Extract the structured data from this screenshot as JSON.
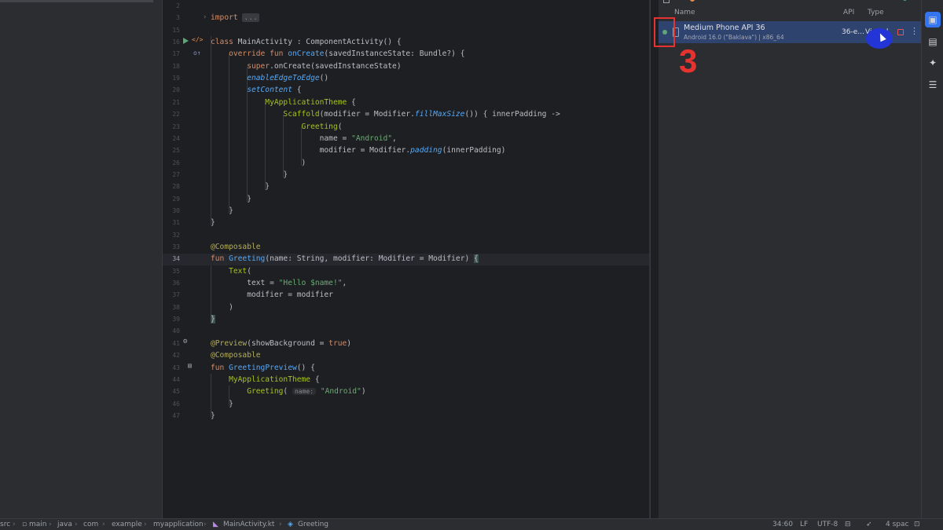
{
  "editor": {
    "lines": [
      {
        "n": "2",
        "tokens": []
      },
      {
        "n": "3",
        "tokens": [
          {
            "c": "kw",
            "t": "import "
          },
          {
            "c": "fold",
            "t": "..."
          }
        ]
      },
      {
        "n": "15",
        "tokens": []
      },
      {
        "n": "16",
        "tokens": [
          {
            "c": "kw",
            "t": "class "
          },
          {
            "c": "txt",
            "t": "MainActivity : ComponentActivity() {"
          }
        ]
      },
      {
        "n": "17",
        "tokens": [
          {
            "c": "kw",
            "t": "    override fun "
          },
          {
            "c": "fn",
            "t": "onCreate"
          },
          {
            "c": "txt",
            "t": "(savedInstanceState: Bundle?) {"
          }
        ]
      },
      {
        "n": "18",
        "tokens": [
          {
            "c": "kw",
            "t": "        super"
          },
          {
            "c": "txt",
            "t": ".onCreate(savedInstanceState)"
          }
        ]
      },
      {
        "n": "19",
        "tokens": [
          {
            "c": "it",
            "t": "        enableEdgeToEdge"
          },
          {
            "c": "txt",
            "t": "()"
          }
        ]
      },
      {
        "n": "20",
        "tokens": [
          {
            "c": "it",
            "t": "        setContent"
          },
          {
            "c": "txt",
            "t": " {"
          }
        ]
      },
      {
        "n": "21",
        "tokens": [
          {
            "c": "cls",
            "t": "            MyApplicationTheme"
          },
          {
            "c": "txt",
            "t": " {"
          }
        ]
      },
      {
        "n": "22",
        "tokens": [
          {
            "c": "cls",
            "t": "                Scaffold"
          },
          {
            "c": "txt",
            "t": "(modifier = Modifier."
          },
          {
            "c": "it",
            "t": "fillMaxSize"
          },
          {
            "c": "txt",
            "t": "()) { innerPadding ->"
          }
        ]
      },
      {
        "n": "23",
        "tokens": [
          {
            "c": "cls",
            "t": "                    Greeting"
          },
          {
            "c": "txt",
            "t": "("
          }
        ]
      },
      {
        "n": "24",
        "tokens": [
          {
            "c": "txt",
            "t": "                        name = "
          },
          {
            "c": "str",
            "t": "\"Android\""
          },
          {
            "c": "txt",
            "t": ","
          }
        ]
      },
      {
        "n": "25",
        "tokens": [
          {
            "c": "txt",
            "t": "                        modifier = Modifier."
          },
          {
            "c": "it",
            "t": "padding"
          },
          {
            "c": "txt",
            "t": "(innerPadding)"
          }
        ]
      },
      {
        "n": "26",
        "tokens": [
          {
            "c": "txt",
            "t": "                    )"
          }
        ]
      },
      {
        "n": "27",
        "tokens": [
          {
            "c": "txt",
            "t": "                }"
          }
        ]
      },
      {
        "n": "28",
        "tokens": [
          {
            "c": "txt",
            "t": "            }"
          }
        ]
      },
      {
        "n": "29",
        "tokens": [
          {
            "c": "txt",
            "t": "        }"
          }
        ]
      },
      {
        "n": "30",
        "tokens": [
          {
            "c": "txt",
            "t": "    }"
          }
        ]
      },
      {
        "n": "31",
        "tokens": [
          {
            "c": "txt",
            "t": "}"
          }
        ]
      },
      {
        "n": "32",
        "tokens": []
      },
      {
        "n": "33",
        "tokens": [
          {
            "c": "ann",
            "t": "@Composable"
          }
        ]
      },
      {
        "n": "34",
        "tokens": [
          {
            "c": "kw",
            "t": "fun "
          },
          {
            "c": "fn",
            "t": "Greeting"
          },
          {
            "c": "txt",
            "t": "(name: String, modifier: Modifier = Modifier) "
          },
          {
            "c": "brace-hl",
            "t": "{"
          }
        ]
      },
      {
        "n": "35",
        "tokens": [
          {
            "c": "cls",
            "t": "    Text"
          },
          {
            "c": "txt",
            "t": "("
          }
        ]
      },
      {
        "n": "36",
        "tokens": [
          {
            "c": "txt",
            "t": "        text = "
          },
          {
            "c": "str",
            "t": "\"Hello $name!\""
          },
          {
            "c": "txt",
            "t": ","
          }
        ]
      },
      {
        "n": "37",
        "tokens": [
          {
            "c": "txt",
            "t": "        modifier = modifier"
          }
        ]
      },
      {
        "n": "38",
        "tokens": [
          {
            "c": "txt",
            "t": "    )"
          }
        ]
      },
      {
        "n": "39",
        "tokens": [
          {
            "c": "brace-hl",
            "t": "}"
          }
        ]
      },
      {
        "n": "40",
        "tokens": []
      },
      {
        "n": "41",
        "tokens": [
          {
            "c": "ann",
            "t": "@Preview"
          },
          {
            "c": "txt",
            "t": "(showBackground = "
          },
          {
            "c": "kw",
            "t": "true"
          },
          {
            "c": "txt",
            "t": ")"
          }
        ]
      },
      {
        "n": "42",
        "tokens": [
          {
            "c": "ann",
            "t": "@Composable"
          }
        ]
      },
      {
        "n": "43",
        "tokens": [
          {
            "c": "kw",
            "t": "fun "
          },
          {
            "c": "fn",
            "t": "GreetingPreview"
          },
          {
            "c": "txt",
            "t": "() {"
          }
        ]
      },
      {
        "n": "44",
        "tokens": [
          {
            "c": "cls",
            "t": "    MyApplicationTheme"
          },
          {
            "c": "txt",
            "t": " {"
          }
        ]
      },
      {
        "n": "45",
        "tokens": [
          {
            "c": "cls",
            "t": "        Greeting"
          },
          {
            "c": "txt",
            "t": "( "
          },
          {
            "c": "hint",
            "t": "name:"
          },
          {
            "c": "str",
            "t": " \"Android\""
          },
          {
            "c": "txt",
            "t": ")"
          }
        ]
      },
      {
        "n": "46",
        "tokens": [
          {
            "c": "txt",
            "t": "    }"
          }
        ]
      },
      {
        "n": "47",
        "tokens": [
          {
            "c": "txt",
            "t": "}"
          }
        ]
      }
    ]
  },
  "device_manager": {
    "columns": {
      "name": "Name",
      "api": "API",
      "type": "Type"
    },
    "device": {
      "name": "Medium Phone API 36",
      "details": "Android 16.0 (\"Baklava\") | x86_64",
      "api": "36-e...",
      "type": "Virtual"
    }
  },
  "annotation": {
    "step": "3",
    "color": "#e5332f"
  },
  "status_bar": {
    "crumbs": [
      "src",
      "main",
      "java",
      "com",
      "example",
      "myapplication",
      "MainActivity.kt",
      "Greeting"
    ],
    "position": "34:60",
    "line_sep": "LF",
    "encoding": "UTF-8",
    "indent": "4 spac"
  },
  "colors": {
    "accent": "#3574f0",
    "selection": "#2e436e",
    "running": "#5fa779",
    "stop": "#e55353"
  }
}
